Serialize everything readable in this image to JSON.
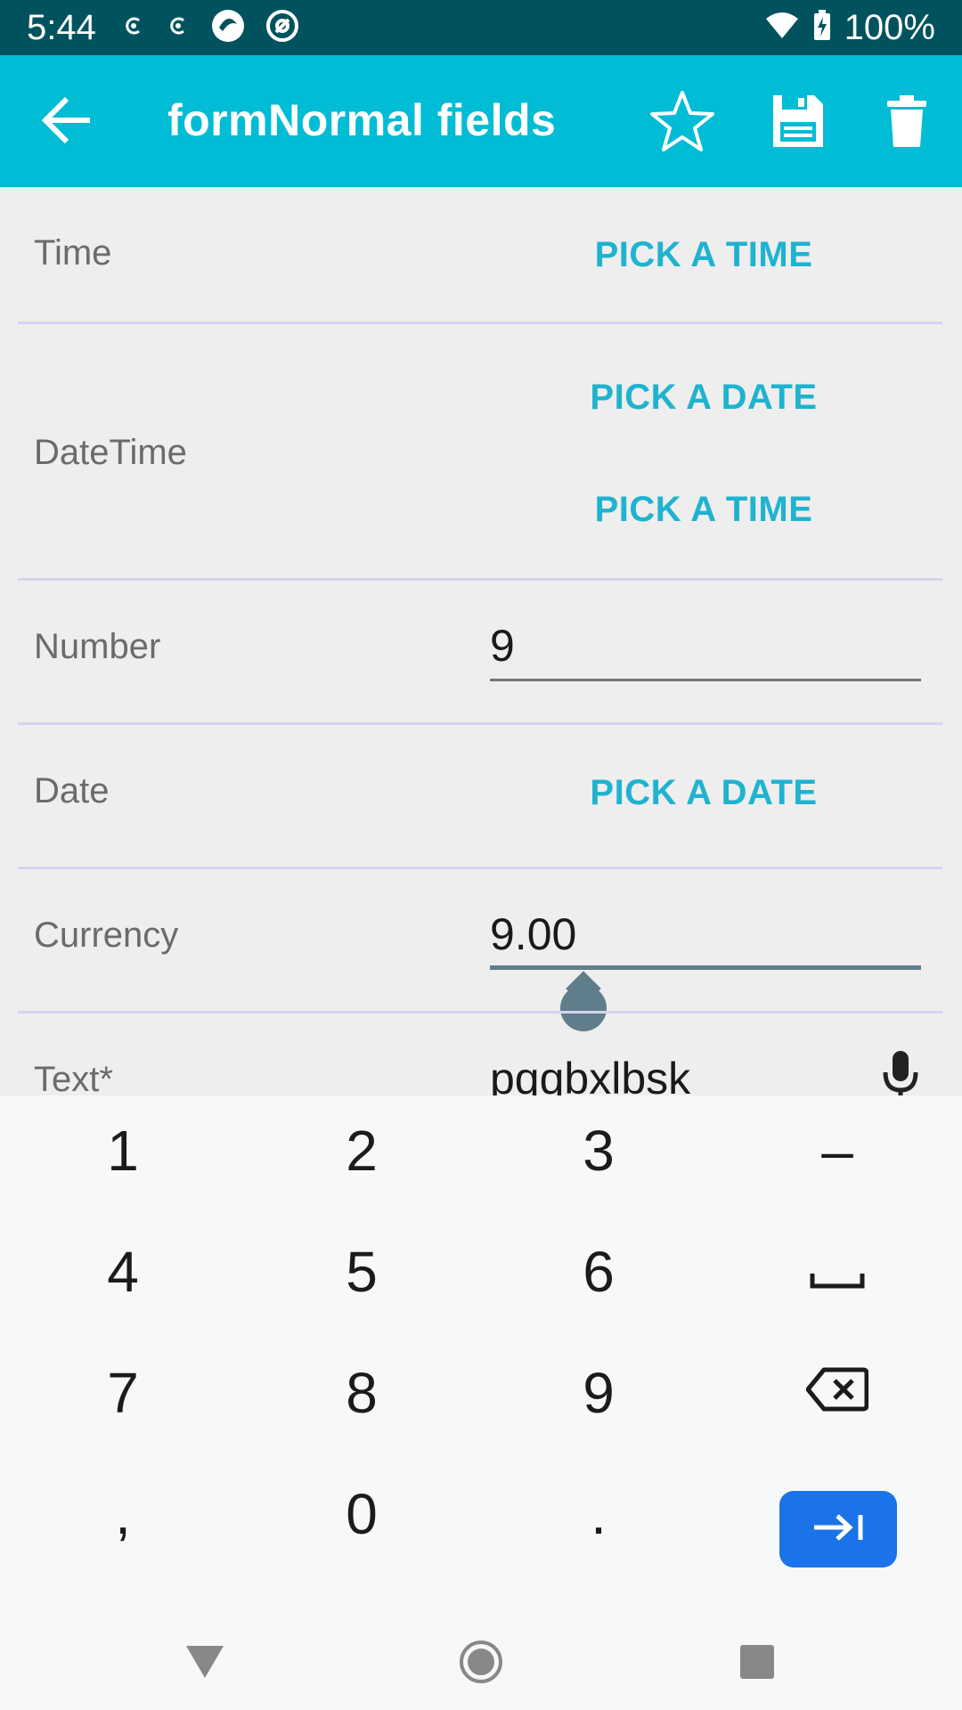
{
  "status_bar": {
    "time": "5:44",
    "battery": "100%",
    "icons_left": [
      "notification-c-icon",
      "notification-c-icon",
      "app-circle-icon",
      "at-circle-icon"
    ],
    "icons_right": [
      "wifi-icon",
      "battery-charging-icon"
    ]
  },
  "app_bar": {
    "title": "formNormal fields",
    "color": "#00bcd4",
    "actions": [
      "star-icon",
      "save-icon",
      "delete-icon"
    ]
  },
  "form": {
    "fields": [
      {
        "label": "Time",
        "type": "time",
        "button": "PICK A TIME"
      },
      {
        "label": "DateTime",
        "type": "datetime",
        "date_button": "PICK A DATE",
        "time_button": "PICK A TIME"
      },
      {
        "label": "Number",
        "type": "number",
        "value": "9"
      },
      {
        "label": "Date",
        "type": "date",
        "button": "PICK A DATE"
      },
      {
        "label": "Currency",
        "type": "currency",
        "value": "9.00"
      },
      {
        "label": "Text*",
        "type": "text",
        "value": "pqqbxlbsk"
      }
    ],
    "accent_color": "#1fb3cf"
  },
  "keyboard": {
    "rows": [
      [
        "1",
        "2",
        "3",
        "–"
      ],
      [
        "4",
        "5",
        "6",
        "␣"
      ],
      [
        "7",
        "8",
        "9",
        "⌫"
      ],
      [
        ",",
        "0",
        ".",
        "→|"
      ]
    ],
    "action_color": "#1a73e8"
  },
  "nav_bar": {
    "buttons": [
      "back-triangle-icon",
      "home-circle-icon",
      "recents-square-icon"
    ]
  }
}
